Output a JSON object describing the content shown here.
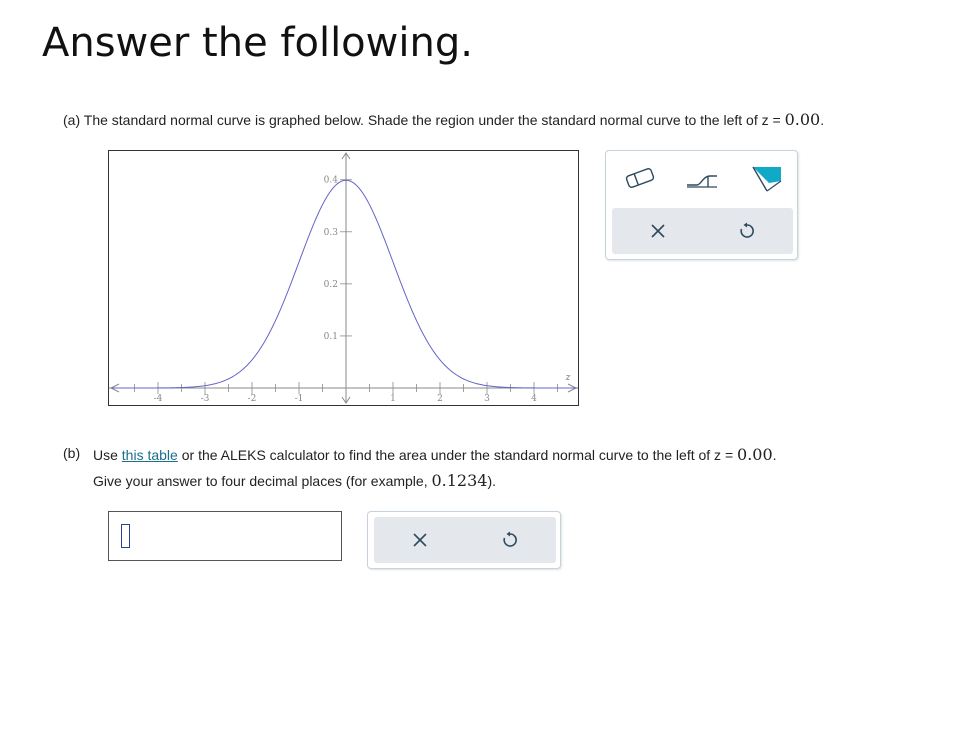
{
  "page": {
    "heading": "Answer the following."
  },
  "part_a": {
    "label": "(a)",
    "text_before": "The standard normal curve is graphed below. Shade the region under the standard normal curve to the left of z",
    "equals": " = ",
    "z_value": "0.00",
    "period": "."
  },
  "graph": {
    "axis_var": "z",
    "y_min": 0,
    "y_max": 0.45,
    "x_min": -5,
    "x_max": 5,
    "x_ticks": [
      "-4",
      "-3",
      "-2",
      "-1",
      "1",
      "2",
      "3",
      "4"
    ],
    "y_ticks": [
      "0.1",
      "0.2",
      "0.3",
      "0.4"
    ],
    "curve_color": "#6464c8"
  },
  "toolbar_a": {
    "tools": [
      "eraser-icon",
      "left-shade-tool-icon",
      "shade-region-tool-icon"
    ],
    "actions": [
      "clear-icon",
      "undo-icon"
    ],
    "accent": "#12a8c8"
  },
  "part_b": {
    "label": "(b)",
    "text_use": "Use ",
    "link_text": "this table",
    "text_after_link": " or the ALEKS calculator to find the area under the standard normal curve to the left of z",
    "equals": " = ",
    "z_value": "0.00",
    "period": ".",
    "line2_before": "Give your answer to four decimal places (for example, ",
    "example": "0.1234",
    "line2_after": ")."
  },
  "answer": {
    "value": "",
    "actions": [
      "clear-icon",
      "undo-icon"
    ]
  }
}
